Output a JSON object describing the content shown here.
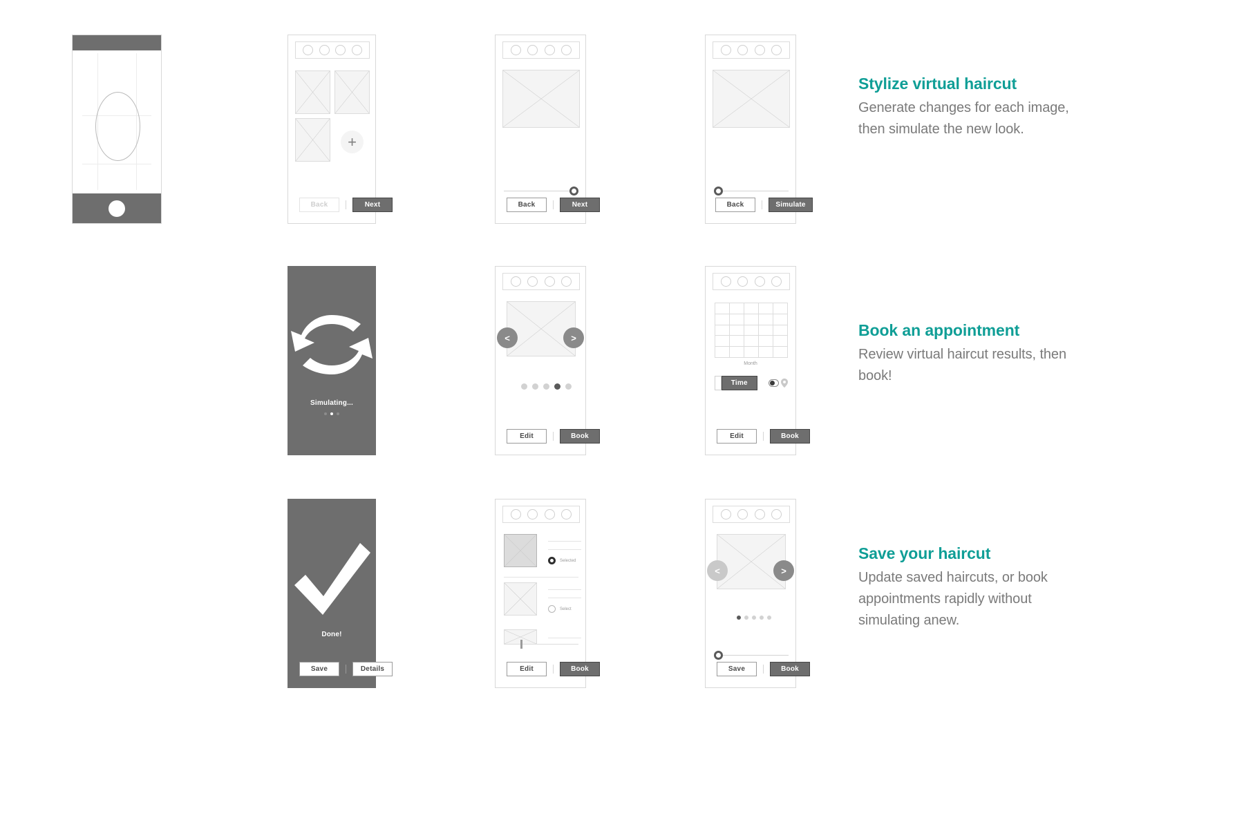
{
  "meta": {
    "accent_color": "#0f9e96",
    "body_text_color": "#7a7a7a",
    "dark_screen_color": "#6e6e6e",
    "placeholder_fill": "#f4f4f4"
  },
  "sections": [
    {
      "title": "Stylize virtual haircut",
      "body": "Generate changes for each image, then simulate the new look."
    },
    {
      "title": "Book an appointment",
      "body": "Review virtual haircut results, then book!"
    },
    {
      "title": "Save your haircut",
      "body": "Update saved haircuts, or book appointments rapidly without simulating anew."
    }
  ],
  "screens": {
    "camera": {
      "name": "camera-capture",
      "shutter_label": "shutter"
    },
    "gallery": {
      "name": "photo-gallery",
      "add_label": "+",
      "back_label": "Back",
      "next_label": "Next",
      "back_state": "disabled",
      "next_state": "primary"
    },
    "adjust_one": {
      "name": "adjust-right",
      "back_label": "Back",
      "next_label": "Next",
      "slider_value": 100
    },
    "adjust_two": {
      "name": "adjust-left",
      "back_label": "Back",
      "simulate_label": "Simulate",
      "slider_value": 0
    },
    "simulating": {
      "name": "simulating-progress",
      "status_label": "Simulating...",
      "dots_total": 3,
      "dots_active_index": 1
    },
    "results": {
      "name": "results-carousel",
      "prev_label": "<",
      "next_label": ">",
      "edit_label": "Edit",
      "book_label": "Book",
      "dots_total": 5,
      "dots_active_index": 3
    },
    "booking": {
      "name": "booking-calendar",
      "month_label": "Month",
      "time_label": "Time",
      "edit_label": "Edit",
      "book_label": "Book",
      "toggle_state": "on"
    },
    "done": {
      "name": "done-confirmation",
      "status_label": "Done!",
      "save_label": "Save",
      "details_label": "Details"
    },
    "saved_list": {
      "name": "saved-haircuts-list",
      "items": [
        {
          "radio_label": "Selected",
          "selected": true
        },
        {
          "radio_label": "Select",
          "selected": false
        }
      ],
      "edit_label": "Edit",
      "book_label": "Book"
    },
    "saved_detail": {
      "name": "saved-haircut-detail",
      "prev_label": "<",
      "next_label": ">",
      "save_label": "Save",
      "book_label": "Book",
      "dots_total": 5,
      "dots_active_index": 0,
      "slider_value": 0
    }
  }
}
